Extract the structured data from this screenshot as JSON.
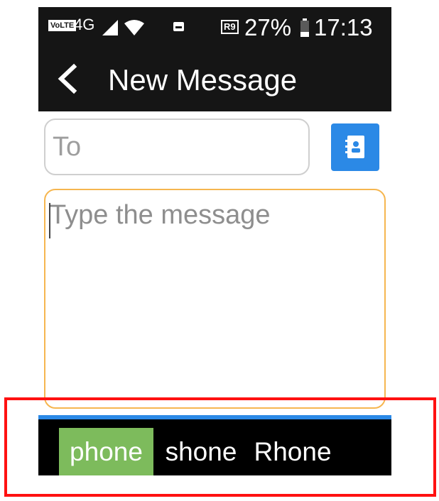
{
  "status_bar": {
    "volte": "VoLTE",
    "network": "4G",
    "roaming": "R9",
    "battery": "27%",
    "time": "17:13"
  },
  "app_bar": {
    "title": "New Message",
    "back_icon": "chevron-left-icon"
  },
  "compose": {
    "to_placeholder": "To",
    "message_placeholder": "Type the message",
    "contacts_icon": "contacts-book-icon"
  },
  "suggestions": {
    "items": [
      "phone",
      "shone",
      "Rhone"
    ],
    "selected_index": 0
  },
  "colors": {
    "bar_bg": "#151515",
    "accent_blue": "#2b89e6",
    "message_border": "#f6b64f",
    "suggestion_selected": "#7dbb5c",
    "highlight": "#ff1111"
  }
}
